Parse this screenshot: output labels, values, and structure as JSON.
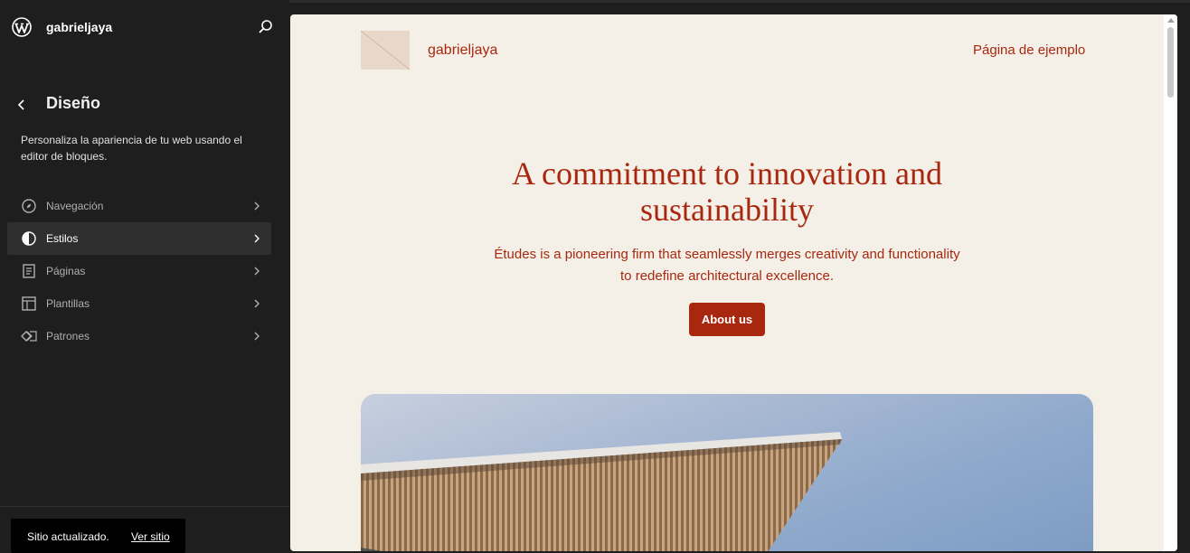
{
  "sidebar": {
    "site_name": "gabrieljaya",
    "title": "Diseño",
    "description": "Personaliza la apariencia de tu web usando el editor de bloques.",
    "items": [
      {
        "label": "Navegación",
        "icon": "navigation-icon"
      },
      {
        "label": "Estilos",
        "icon": "styles-icon",
        "active": true
      },
      {
        "label": "Páginas",
        "icon": "pages-icon"
      },
      {
        "label": "Plantillas",
        "icon": "templates-icon"
      },
      {
        "label": "Patrones",
        "icon": "patterns-icon"
      }
    ]
  },
  "snackbar": {
    "message": "Sitio actualizado.",
    "action": "Ver sitio"
  },
  "preview": {
    "site_title": "gabrieljaya",
    "nav_link": "Página de ejemplo",
    "hero_heading": "A commitment to innovation and sustainability",
    "hero_subtitle": "Études is a pioneering firm that seamlessly merges creativity and functionality to redefine architectural excellence.",
    "hero_button": "About us"
  },
  "colors": {
    "sidebar_bg": "#1e1e1e",
    "preview_bg": "#f4f0e8",
    "accent": "#a8280f"
  }
}
